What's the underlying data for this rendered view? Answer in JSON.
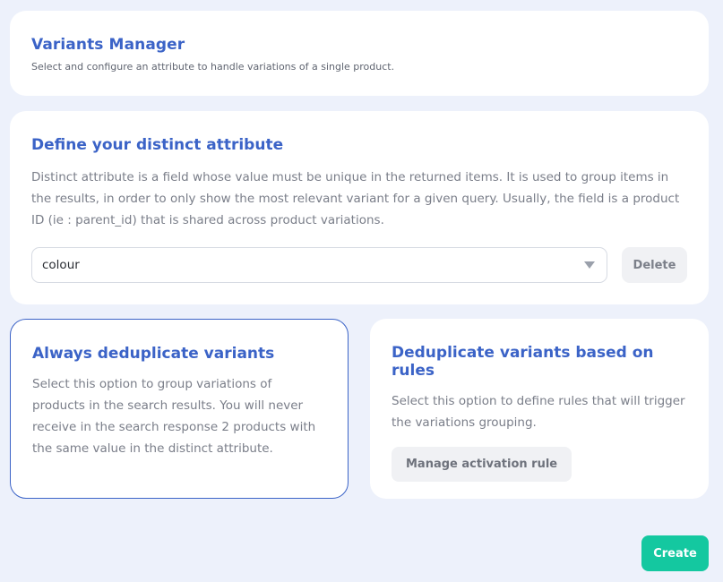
{
  "header": {
    "title": "Variants Manager",
    "subtitle": "Select and configure an attribute to handle variations of a single product."
  },
  "distinct_attribute": {
    "title": "Define your distinct attribute",
    "description": "Distinct attribute is a field whose value must be unique in the returned items. It is used to group items in the results, in order to only show the most relevant variant for a given query. Usually, the field is a product ID (ie : parent_id) that is shared across product variations.",
    "selected_value": "colour",
    "delete_label": "Delete"
  },
  "options": [
    {
      "title": "Always deduplicate variants",
      "description": "Select this option to group variations of products in the search results. You will never receive in the search response 2 products with the same value in the distinct attribute.",
      "selected": true
    },
    {
      "title": "Deduplicate variants based on rules",
      "description": "Select this option to define rules that will trigger the variations grouping.",
      "button_label": "Manage activation rule",
      "selected": false
    }
  ],
  "footer": {
    "create_label": "Create"
  },
  "colors": {
    "accent": "#3b63c7",
    "create": "#14c8a0",
    "background": "#edf1fb"
  }
}
